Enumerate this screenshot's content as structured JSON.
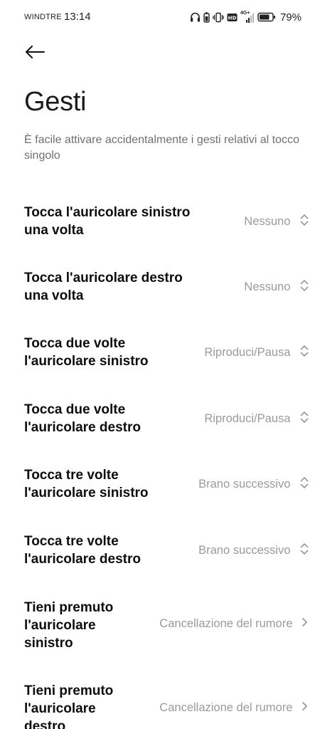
{
  "status_bar": {
    "carrier": "WINDTRE",
    "time": "13:14",
    "network": "4G+",
    "battery_percent": "79%",
    "icons": [
      "headphones-icon",
      "earbud-battery-icon",
      "vibrate-icon",
      "hd-icon",
      "signal-icon",
      "battery-icon"
    ]
  },
  "header": {
    "back_icon": "arrow-left-icon",
    "title": "Gesti",
    "description": "È facile attivare accidentalmente i gesti relativi al tocco singolo"
  },
  "gestures": [
    {
      "label_line1": "Tocca l'auricolare sinistro",
      "label_line2": "una volta",
      "label_line3": "",
      "value": "Nessuno",
      "control_icon": "up-down-chevron-icon"
    },
    {
      "label_line1": "Tocca l'auricolare destro",
      "label_line2": "una volta",
      "label_line3": "",
      "value": "Nessuno",
      "control_icon": "up-down-chevron-icon"
    },
    {
      "label_line1": "Tocca due volte",
      "label_line2": "l'auricolare sinistro",
      "label_line3": "",
      "value": "Riproduci/Pausa",
      "control_icon": "up-down-chevron-icon"
    },
    {
      "label_line1": "Tocca due volte",
      "label_line2": "l'auricolare destro",
      "label_line3": "",
      "value": "Riproduci/Pausa",
      "control_icon": "up-down-chevron-icon"
    },
    {
      "label_line1": "Tocca tre volte",
      "label_line2": "l'auricolare sinistro",
      "label_line3": "",
      "value": "Brano successivo",
      "control_icon": "up-down-chevron-icon"
    },
    {
      "label_line1": "Tocca tre volte",
      "label_line2": "l'auricolare destro",
      "label_line3": "",
      "value": "Brano successivo",
      "control_icon": "up-down-chevron-icon"
    },
    {
      "label_line1": "Tieni premuto",
      "label_line2": "l'auricolare",
      "label_line3": "sinistro",
      "value": "Cancellazione del rumore",
      "control_icon": "chevron-right-icon"
    },
    {
      "label_line1": "Tieni premuto",
      "label_line2": "l'auricolare",
      "label_line3": "destro",
      "value": "Cancellazione del rumore",
      "control_icon": "chevron-right-icon"
    }
  ],
  "colors": {
    "title": "#1c1c1c",
    "description": "#6f6f6f",
    "label": "#0d0d0d",
    "value": "#9a9a9a",
    "background": "#ffffff"
  }
}
